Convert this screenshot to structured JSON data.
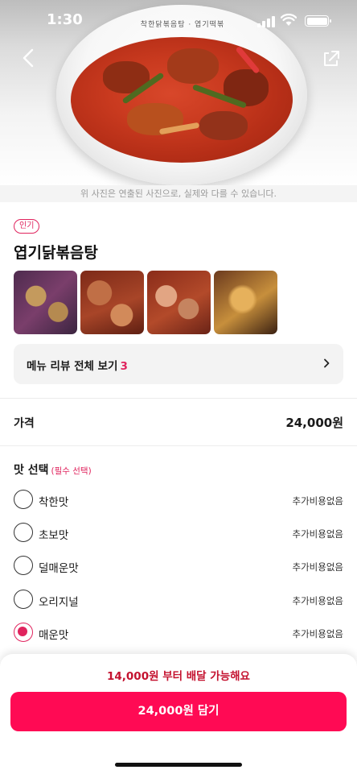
{
  "status_bar": {
    "time": "1:30"
  },
  "hero": {
    "logo_text": "착한닭볶음탕 · 엽기떡볶이",
    "note": "위 사진은 연출된 사진으로, 실제와 다를 수 있습니다."
  },
  "menu": {
    "badge": "인기",
    "title": "엽기닭볶음탕",
    "review_label": "메뉴 리뷰 전체 보기",
    "review_count": "3"
  },
  "price": {
    "label": "가격",
    "value": "24,000원"
  },
  "taste": {
    "title": "맛 선택",
    "required": "(필수 선택)",
    "options": [
      {
        "label": "착한맛",
        "extra": "추가비용없음",
        "selected": false
      },
      {
        "label": "초보맛",
        "extra": "추가비용없음",
        "selected": false
      },
      {
        "label": "덜매운맛",
        "extra": "추가비용없음",
        "selected": false
      },
      {
        "label": "오리지널",
        "extra": "추가비용없음",
        "selected": false
      },
      {
        "label": "매운맛",
        "extra": "추가비용없음",
        "selected": true
      }
    ]
  },
  "bottom": {
    "min_order": "14,000원 부터 배달 가능해요",
    "add_button": "24,000원 담기"
  },
  "colors": {
    "accent": "#ff0a54",
    "badge": "#e0245e",
    "min_order": "#c4122f"
  }
}
